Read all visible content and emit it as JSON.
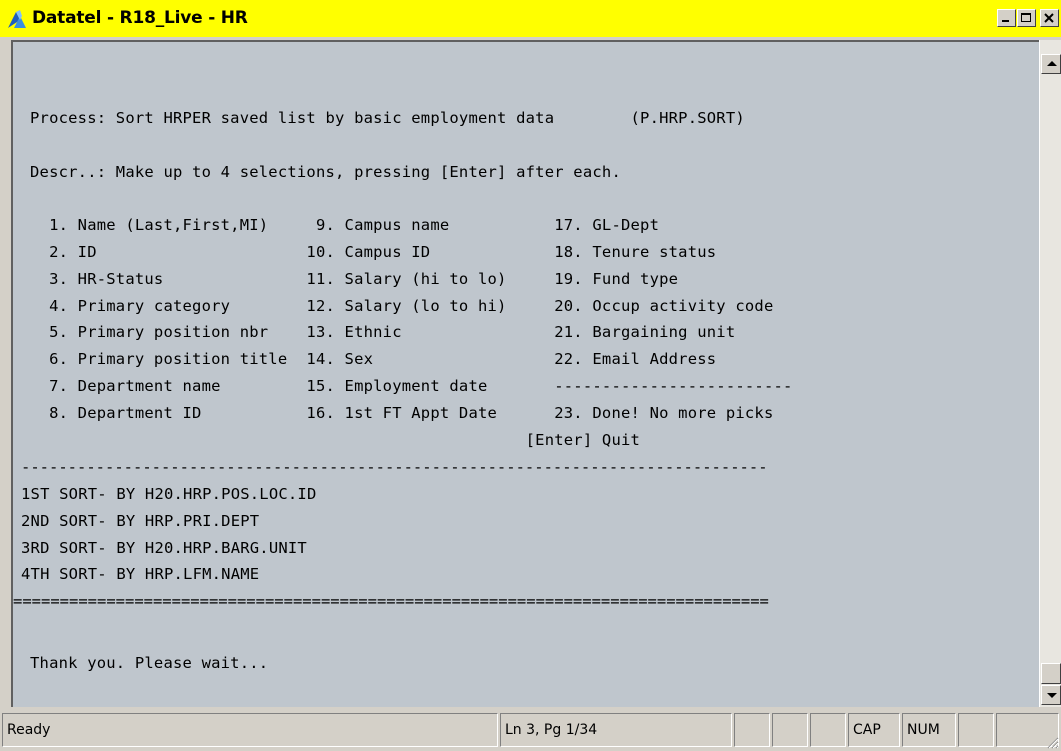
{
  "window": {
    "title": "Datatel - R18_Live - HR",
    "min_label": "_",
    "max_label": "□",
    "close_label": "×"
  },
  "terminal": {
    "process_line": "Process: Sort HRPER saved list by basic employment data        (P.HRP.SORT)",
    "descr_line": "Descr..: Make up to 4 selections, pressing [Enter] after each.",
    "menu_rows": [
      "  1. Name (Last,First,MI)     9. Campus name           17. GL-Dept",
      "  2. ID                      10. Campus ID             18. Tenure status",
      "  3. HR-Status               11. Salary (hi to lo)     19. Fund type",
      "  4. Primary category        12. Salary (lo to hi)     20. Occup activity code",
      "  5. Primary position nbr    13. Ethnic                21. Bargaining unit",
      "  6. Primary position title  14. Sex                   22. Email Address",
      "  7. Department name         15. Employment date       -------------------------",
      "  8. Department ID           16. 1st FT Appt Date      23. Done! No more picks",
      "                                                    [Enter] Quit"
    ],
    "dash_rule": "--------------------------------------------------------------------------------",
    "sort_lines": [
      "1ST SORT- BY H20.HRP.POS.LOC.ID",
      "2ND SORT- BY HRP.PRI.DEPT",
      "3RD SORT- BY H20.HRP.BARG.UNIT",
      "4TH SORT- BY HRP.LFM.NAME"
    ],
    "equals_rule": "=================================================================================",
    "wait_line": "Thank you. Please wait..."
  },
  "status": {
    "ready": "Ready",
    "position": "Ln 3, Pg 1/34",
    "cap": "CAP",
    "num": "NUM"
  },
  "colors": {
    "titlebar": "#ffff00",
    "terminal_bg": "#bfc6cd",
    "chrome": "#d4d0c8"
  }
}
